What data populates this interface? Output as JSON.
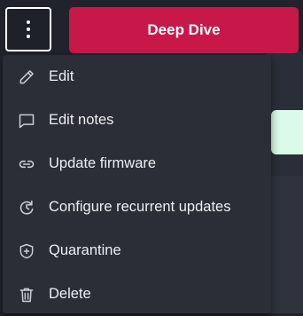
{
  "toolbar": {
    "more_icon": "more-vertical-icon",
    "deep_dive_label": "Deep Dive",
    "deep_dive_color": "#c8184a"
  },
  "menu": {
    "items": [
      {
        "label": "Edit",
        "icon": "pencil-icon"
      },
      {
        "label": "Edit notes",
        "icon": "comment-icon"
      },
      {
        "label": "Update firmware",
        "icon": "link-icon"
      },
      {
        "label": "Configure recurrent updates",
        "icon": "refresh-clock-icon"
      },
      {
        "label": "Quarantine",
        "icon": "shield-plus-icon"
      },
      {
        "label": "Delete",
        "icon": "trash-icon"
      }
    ]
  }
}
